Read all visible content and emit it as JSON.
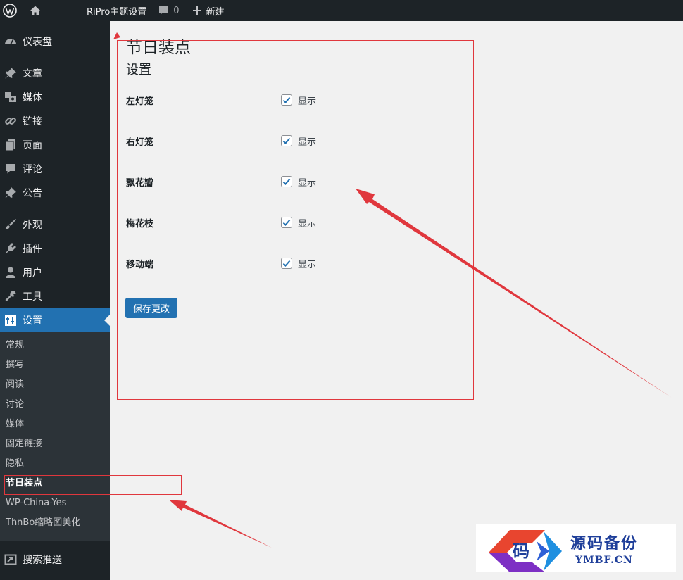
{
  "adminbar": {
    "site_name": "RiPro主题设置",
    "comment_count": "0",
    "new_label": "新建"
  },
  "sidebar": {
    "items": [
      {
        "label": "仪表盘",
        "icon": "dashboard-icon"
      },
      {
        "label": "文章",
        "icon": "pin-icon"
      },
      {
        "label": "媒体",
        "icon": "media-icon"
      },
      {
        "label": "链接",
        "icon": "link-icon"
      },
      {
        "label": "页面",
        "icon": "page-icon"
      },
      {
        "label": "评论",
        "icon": "comment-icon"
      },
      {
        "label": "公告",
        "icon": "pin-icon"
      },
      {
        "label": "外观",
        "icon": "brush-icon"
      },
      {
        "label": "插件",
        "icon": "plugin-icon"
      },
      {
        "label": "用户",
        "icon": "user-icon"
      },
      {
        "label": "工具",
        "icon": "wrench-icon"
      },
      {
        "label": "设置",
        "icon": "settings-icon"
      },
      {
        "label": "搜索推送",
        "icon": "push-icon"
      }
    ],
    "submenu": [
      "常规",
      "撰写",
      "阅读",
      "讨论",
      "媒体",
      "固定链接",
      "隐私",
      "节日装点",
      "WP-China-Yes",
      "ThnBo缩略图美化"
    ]
  },
  "main": {
    "title": "节日装点",
    "section": "设置",
    "fields": [
      {
        "label": "左灯笼",
        "checkbox_label": "显示",
        "checked": true
      },
      {
        "label": "右灯笼",
        "checkbox_label": "显示",
        "checked": true
      },
      {
        "label": "飘花瓣",
        "checkbox_label": "显示",
        "checked": true
      },
      {
        "label": "梅花枝",
        "checkbox_label": "显示",
        "checked": true
      },
      {
        "label": "移动端",
        "checkbox_label": "显示",
        "checked": true
      }
    ],
    "save_label": "保存更改"
  },
  "watermark": {
    "logo_char": "码",
    "cn": "源码备份",
    "en": "YMBF.CN"
  },
  "colors": {
    "accent": "#2271b1",
    "sidebar_bg": "#1d2327",
    "annotation": "#e0373d"
  }
}
